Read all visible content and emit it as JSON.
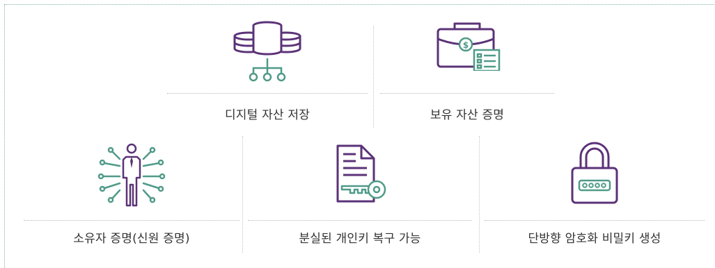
{
  "colors": {
    "purple": "#5b3278",
    "teal": "#4f9a88",
    "dotted_line": "#b8b8b8"
  },
  "features": [
    {
      "icon": "database-icon",
      "label": "디지털 자산 저장"
    },
    {
      "icon": "briefcase-document-icon",
      "label": "보유 자산 증명"
    },
    {
      "icon": "person-network-icon",
      "label": "소유자 증명(신원 증명)"
    },
    {
      "icon": "document-key-icon",
      "label": "분실된 개인키 복구 가능"
    },
    {
      "icon": "padlock-password-icon",
      "label": "단방향 암호화 비밀키 생성"
    }
  ],
  "icon_text": {
    "coin_symbol": "$"
  }
}
